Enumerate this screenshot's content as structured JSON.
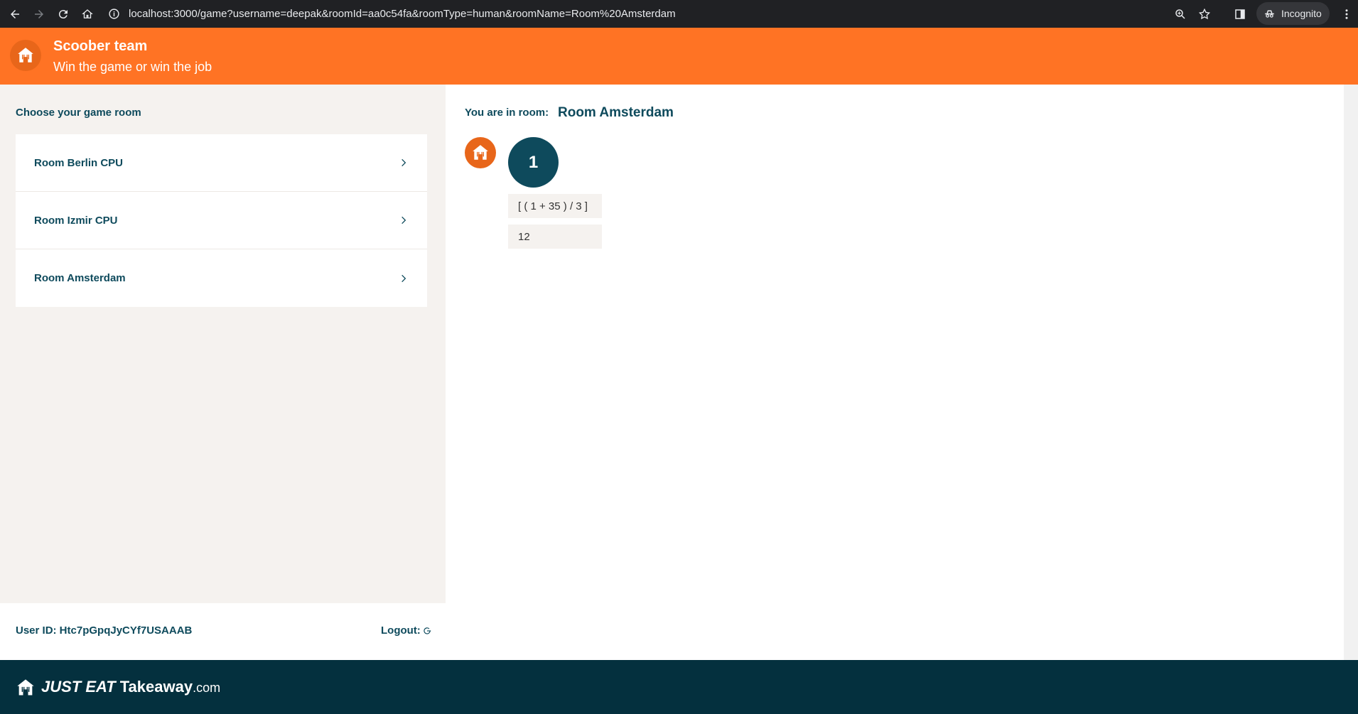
{
  "browser": {
    "url": "localhost:3000/game?username=deepak&roomId=aa0c54fa&roomType=human&roomName=Room%20Amsterdam",
    "incognito_label": "Incognito"
  },
  "header": {
    "title": "Scoober team",
    "subtitle": "Win the game or win the job",
    "brand_color": "#ff7324"
  },
  "sidebar": {
    "heading": "Choose your game room",
    "rooms": [
      {
        "label": "Room Berlin CPU"
      },
      {
        "label": "Room Izmir CPU"
      },
      {
        "label": "Room Amsterdam"
      }
    ]
  },
  "user": {
    "id_label": "User ID: Htc7pGpqJyCYf7USAAAB",
    "logout_label": "Logout:"
  },
  "game": {
    "room_prefix": "You are in room:",
    "room_name": "Room Amsterdam",
    "moves": [
      {
        "number": "1",
        "calculation": "[ ( 1 + 35 ) / 3 ]",
        "result": "12"
      }
    ]
  },
  "footer": {
    "brand_part1": "JUST EAT",
    "brand_part2": "Takeaway",
    "brand_part3": ".com",
    "bg_color": "#04303e"
  }
}
